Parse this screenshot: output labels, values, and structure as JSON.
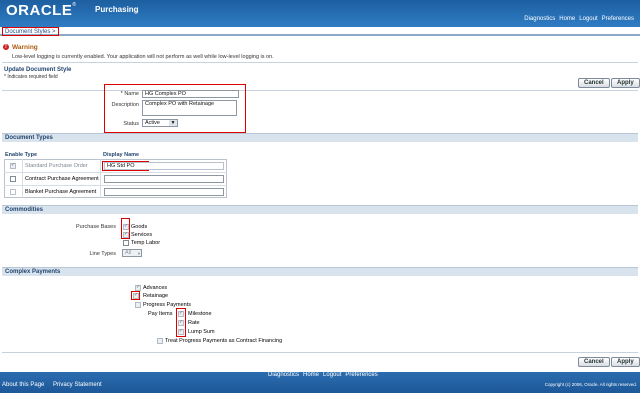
{
  "header": {
    "logo": "ORACLE",
    "app_title": "Purchasing",
    "global_links": [
      "Diagnostics",
      "Home",
      "Logout",
      "Preferences"
    ]
  },
  "breadcrumb": "Document Styles  >",
  "warning": {
    "title": "Warning",
    "message": "Low-level logging is currently enabled. Your application will not perform as well while low-level logging is on."
  },
  "page": {
    "title": "Update Document Style",
    "required_note": "* Indicates required field",
    "cancel_label": "Cancel",
    "apply_label": "Apply"
  },
  "form": {
    "name_label": "* Name",
    "name_value": "HG Complex PO",
    "description_label": "Description",
    "description_value": "Complex PO with Retainage",
    "status_label": "Status",
    "status_value": "Active"
  },
  "document_types": {
    "section_title": "Document Types",
    "col_enable": "Enable",
    "col_type": "Type",
    "col_display": "Display Name",
    "rows": [
      {
        "type": "Standard Purchase Order",
        "display": "HG Std PO",
        "checked": true,
        "disabled": true
      },
      {
        "type": "Contract Purchase Agreement",
        "display": "",
        "checked": false,
        "disabled": false
      },
      {
        "type": "Blanket Purchase Agreement",
        "display": "",
        "checked": false,
        "disabled": false
      }
    ]
  },
  "commodities": {
    "section_title": "Commodities",
    "purchase_bases_label": "Purchase Bases",
    "bases": [
      "Goods",
      "Services",
      "Temp Labor"
    ],
    "line_types_label": "Line Types",
    "line_types_value": "All"
  },
  "complex_payments": {
    "section_title": "Complex Payments",
    "advances": "Advances",
    "retainage": "Retainage",
    "progress_payments": "Progress Payments",
    "pay_items_label": "Pay Items",
    "milestone": "Milestone",
    "rate": "Rate",
    "lump_sum": "Lump Sum",
    "treat_progress": "Treat Progress Payments as Contract Financing"
  },
  "footer": {
    "links": [
      "Diagnostics",
      "Home",
      "Logout",
      "Preferences"
    ],
    "about": "About this Page",
    "privacy": "Privacy Statement",
    "copyright": "Copyright (c) 2006, Oracle. All rights reserved."
  },
  "colors": {
    "header_blue": "#1d5fa0",
    "section_bg": "#d9e3ee",
    "highlight_red": "#dd0000"
  }
}
